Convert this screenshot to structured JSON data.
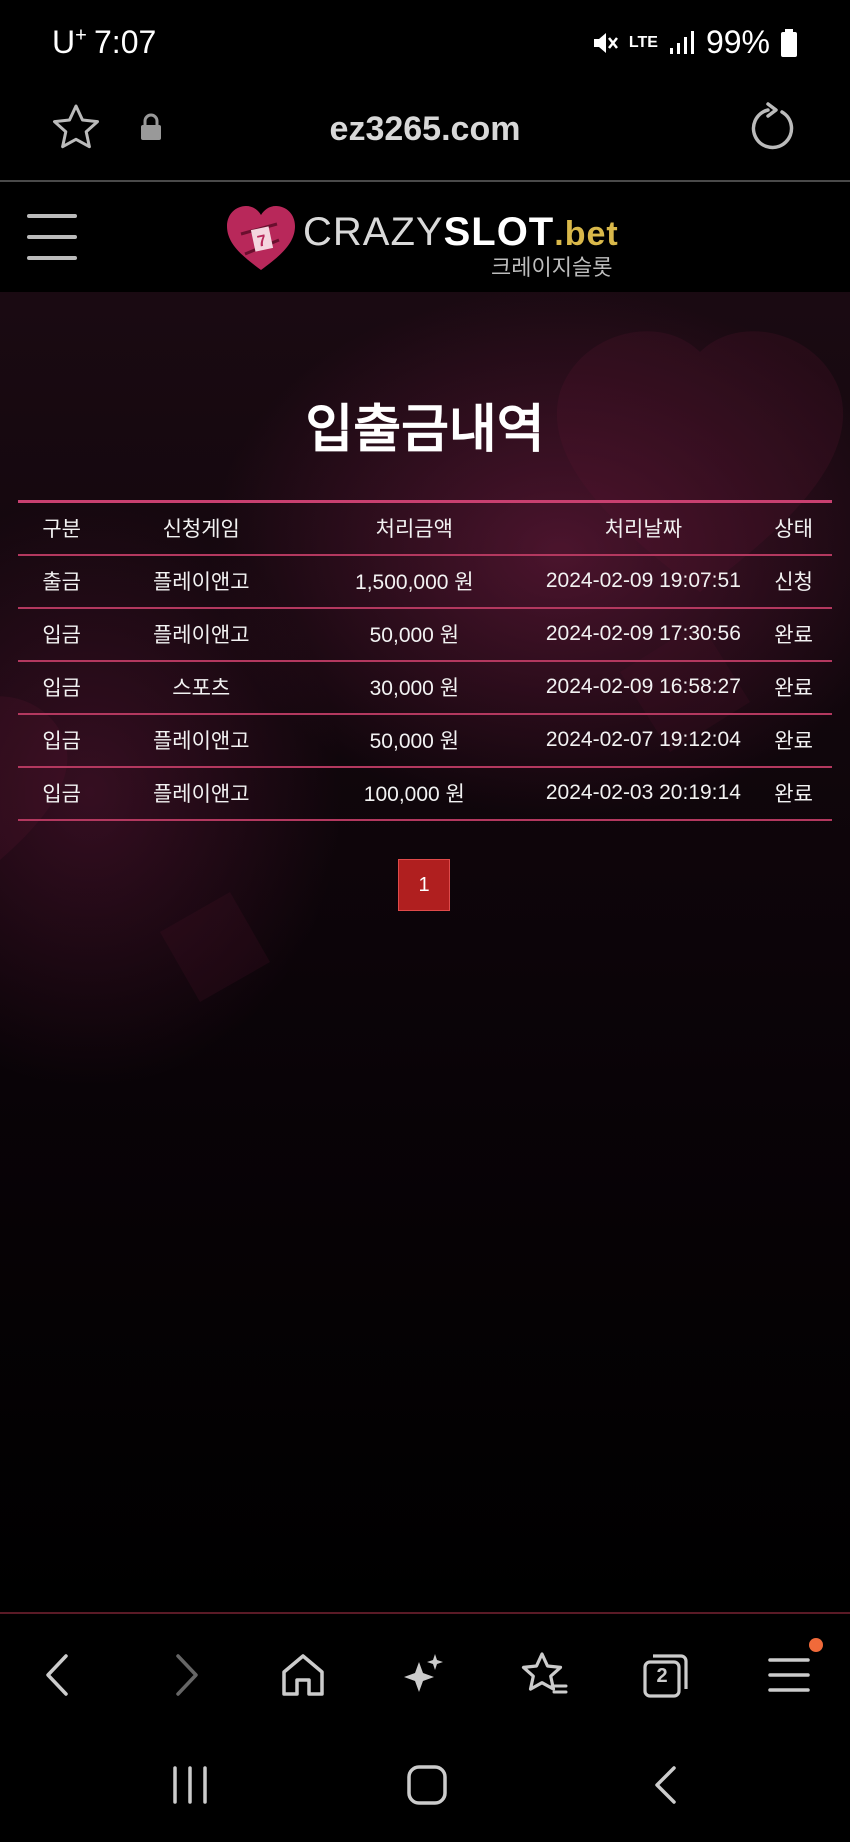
{
  "status_bar": {
    "carrier": "U",
    "carrier_sup": "+",
    "time": "7:07",
    "network": "LTE",
    "battery": "99%"
  },
  "browser": {
    "url": "ez3265.com"
  },
  "site": {
    "logo_crazy": "CRAZY",
    "logo_slot": "SLOT",
    "logo_bet": ".bet",
    "logo_sub": "크레이지슬롯"
  },
  "page": {
    "title": "입출금내역",
    "columns": [
      "구분",
      "신청게임",
      "처리금액",
      "처리날짜",
      "상태"
    ],
    "rows": [
      {
        "type": "출금",
        "game": "플레이앤고",
        "amount": "1,500,000 원",
        "date": "2024-02-09 19:07:51",
        "status": "신청"
      },
      {
        "type": "입금",
        "game": "플레이앤고",
        "amount": "50,000 원",
        "date": "2024-02-09 17:30:56",
        "status": "완료"
      },
      {
        "type": "입금",
        "game": "스포츠",
        "amount": "30,000 원",
        "date": "2024-02-09 16:58:27",
        "status": "완료"
      },
      {
        "type": "입금",
        "game": "플레이앤고",
        "amount": "50,000 원",
        "date": "2024-02-07 19:12:04",
        "status": "완료"
      },
      {
        "type": "입금",
        "game": "플레이앤고",
        "amount": "100,000 원",
        "date": "2024-02-03 20:19:14",
        "status": "완료"
      }
    ],
    "pagination": {
      "current": "1"
    }
  },
  "browser_bar": {
    "tab_count": "2"
  },
  "colors": {
    "accent": "#c84070",
    "pager": "#b01f1f",
    "bet": "#d9b84a"
  }
}
